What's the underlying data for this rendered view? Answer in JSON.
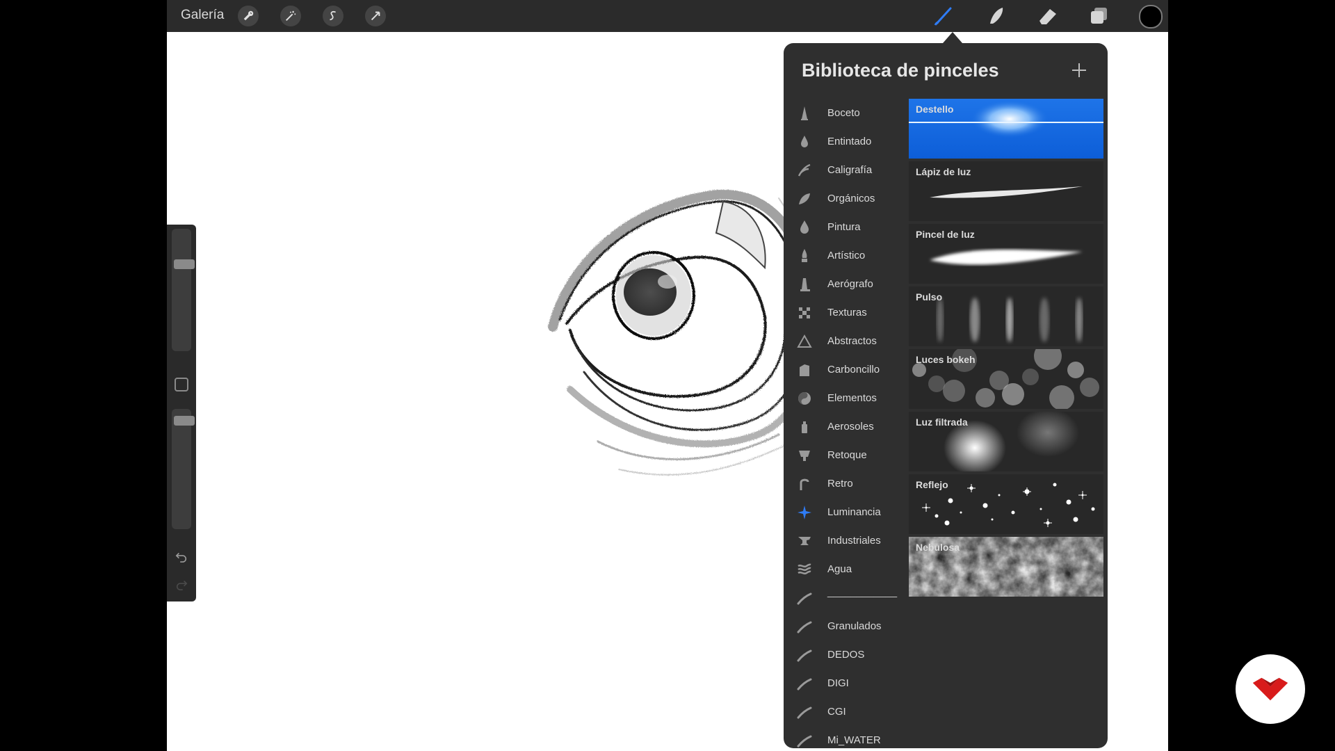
{
  "topbar": {
    "gallery_label": "Galería",
    "left_tools": [
      {
        "name": "wrench-icon"
      },
      {
        "name": "magic-wand-icon"
      },
      {
        "name": "selection-icon"
      },
      {
        "name": "transform-arrow-icon"
      }
    ],
    "right_tools": [
      {
        "name": "brush-icon",
        "active": true
      },
      {
        "name": "smudge-icon"
      },
      {
        "name": "eraser-icon"
      },
      {
        "name": "layers-icon"
      }
    ],
    "current_color": "#000000",
    "accent_color": "#2f7cf6"
  },
  "panel": {
    "title": "Biblioteca de pinceles",
    "categories": [
      {
        "label": "Boceto",
        "icon": "pencil-tip-icon"
      },
      {
        "label": "Entintado",
        "icon": "ink-drop-icon"
      },
      {
        "label": "Caligrafía",
        "icon": "calligraphy-icon"
      },
      {
        "label": "Orgánicos",
        "icon": "leaf-icon"
      },
      {
        "label": "Pintura",
        "icon": "paint-drop-icon"
      },
      {
        "label": "Artístico",
        "icon": "flame-brush-icon"
      },
      {
        "label": "Aerógrafo",
        "icon": "airbrush-icon"
      },
      {
        "label": "Texturas",
        "icon": "texture-icon"
      },
      {
        "label": "Abstractos",
        "icon": "triangle-icon"
      },
      {
        "label": "Carboncillo",
        "icon": "charcoal-icon"
      },
      {
        "label": "Elementos",
        "icon": "yin-yang-icon"
      },
      {
        "label": "Aerosoles",
        "icon": "spray-can-icon"
      },
      {
        "label": "Retoque",
        "icon": "retouch-icon"
      },
      {
        "label": "Retro",
        "icon": "retro-icon"
      },
      {
        "label": "Luminancia",
        "icon": "sparkle-icon",
        "active": true
      },
      {
        "label": "Industriales",
        "icon": "anvil-icon"
      },
      {
        "label": "Agua",
        "icon": "waves-icon"
      },
      {
        "label": "____________",
        "icon": "stroke-icon",
        "separator": true
      },
      {
        "label": "Granulados",
        "icon": "stroke-icon"
      },
      {
        "label": "DEDOS",
        "icon": "stroke-icon"
      },
      {
        "label": "DIGI",
        "icon": "stroke-icon"
      },
      {
        "label": "CGI",
        "icon": "stroke-icon"
      },
      {
        "label": "Mi_WATER",
        "icon": "stroke-icon"
      }
    ],
    "brushes": [
      {
        "name": "Destello",
        "selected": true
      },
      {
        "name": "Lápiz de luz"
      },
      {
        "name": "Pincel de luz"
      },
      {
        "name": "Pulso"
      },
      {
        "name": "Luces bokeh"
      },
      {
        "name": "Luz filtrada"
      },
      {
        "name": "Reflejo"
      },
      {
        "name": "Nebulosa"
      }
    ]
  },
  "sidebar": {
    "brush_size": 0.75,
    "opacity": 0.9
  }
}
